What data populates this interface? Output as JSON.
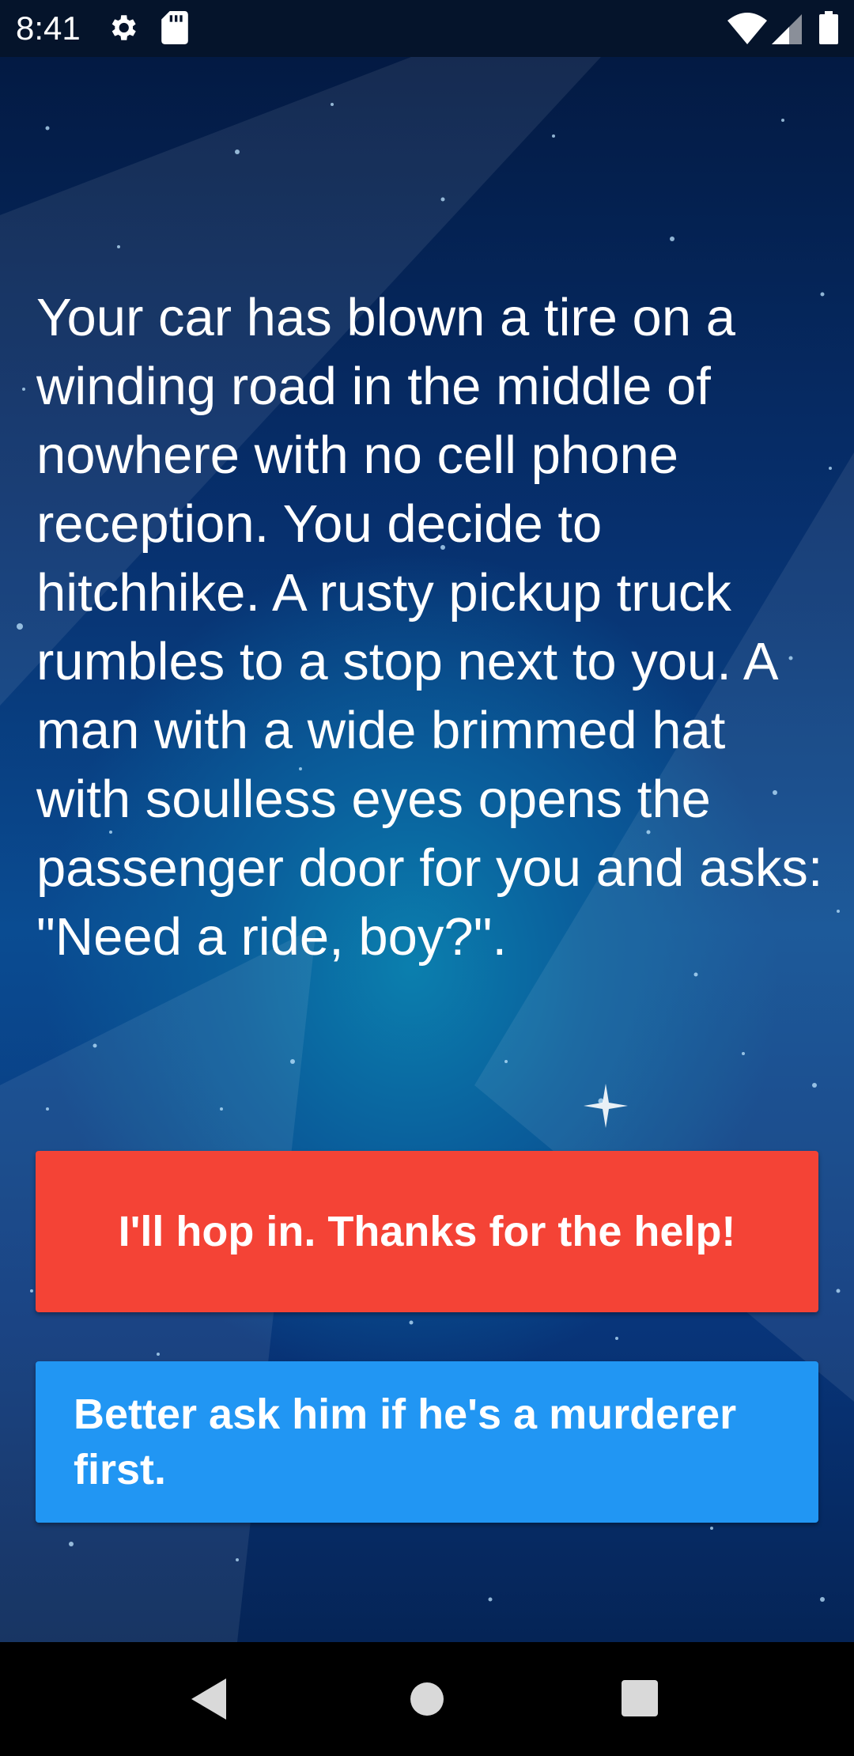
{
  "status_bar": {
    "time": "8:41",
    "icons": [
      "gear-icon",
      "sd-card-icon",
      "wifi-icon",
      "signal-icon",
      "battery-icon"
    ]
  },
  "story": {
    "text": "Your car has blown a tire on a winding road in the middle of nowhere with no cell phone reception. You decide to hitchhike. A rusty pickup truck rumbles to a stop next to you. A man with a wide brimmed hat with soulless eyes opens the passenger door for you and asks: \"Need a ride, boy?\"."
  },
  "choices": [
    {
      "label": "I'll hop in. Thanks for the help!",
      "color": "#f44336"
    },
    {
      "label": "Better ask him if he's a murderer first.",
      "color": "#2196f3"
    }
  ],
  "nav_bar": {
    "icons": [
      "back-icon",
      "home-icon",
      "recents-icon"
    ]
  }
}
